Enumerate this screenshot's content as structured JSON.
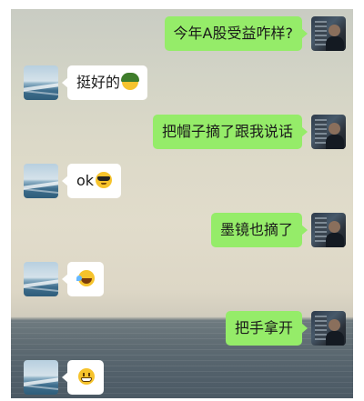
{
  "chat": {
    "messages": [
      {
        "sender": "me",
        "text": "今年A股受益咋样?",
        "emoji": ""
      },
      {
        "sender": "other",
        "text": "挺好的",
        "emoji": "helmet-face-emoji"
      },
      {
        "sender": "me",
        "text": "把帽子摘了跟我说话",
        "emoji": ""
      },
      {
        "sender": "other",
        "text": "ok",
        "emoji": "sunglasses-face-emoji"
      },
      {
        "sender": "me",
        "text": "墨镜也摘了",
        "emoji": ""
      },
      {
        "sender": "other",
        "text": "",
        "emoji": "tears-of-joy-emoji"
      },
      {
        "sender": "me",
        "text": "把手拿开",
        "emoji": ""
      },
      {
        "sender": "other",
        "text": "",
        "emoji": "grimacing-face-emoji"
      }
    ]
  },
  "colors": {
    "my_bubble": "#95ec69",
    "other_bubble": "#ffffff",
    "text": "#1a1a1a"
  }
}
